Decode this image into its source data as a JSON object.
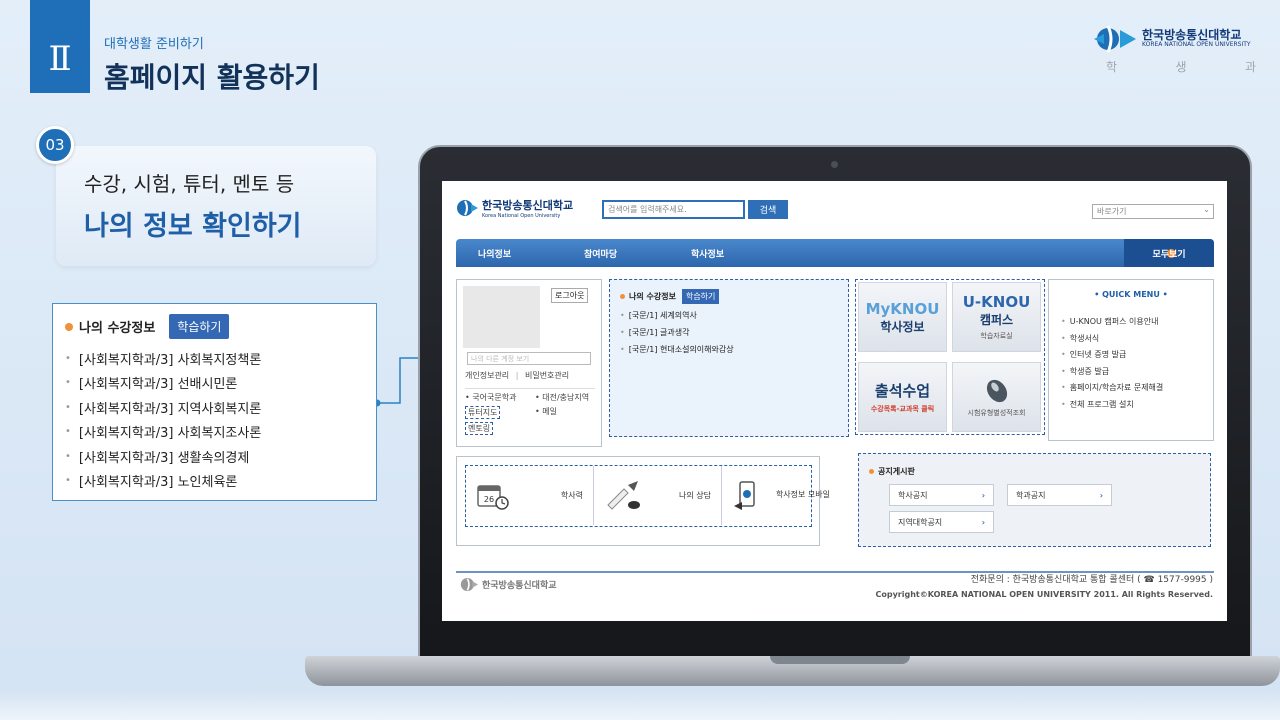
{
  "header": {
    "roman": "Ⅱ",
    "subtitle": "대학생활 준비하기",
    "title": "홈페이지 활용하기",
    "logo_name": "한국방송통신대학교",
    "logo_eng": "KOREA NATIONAL OPEN UNIVERSITY",
    "logo_sub": [
      "학",
      "생",
      "과"
    ]
  },
  "step": {
    "number": "03",
    "line1": "수강, 시험, 튜터, 멘토 등",
    "line2": "나의 정보 확인하기"
  },
  "callout": {
    "heading": "나의 수강정보",
    "button": "학습하기",
    "items": [
      "[사회복지학과/3] 사회복지정책론",
      "[사회복지학과/3] 선배시민론",
      "[사회복지학과/3] 지역사회복지론",
      "[사회복지학과/3] 사회복지조사론",
      "[사회복지학과/3] 생활속의경제",
      "[사회복지학과/3] 노인체육론"
    ]
  },
  "screen": {
    "logo_text": "한국방송통신대학교",
    "logo_sub": "Korea National Open University",
    "search_placeholder": "검색어를 입력해주세요.",
    "search_btn": "검색",
    "goto": "바로가기",
    "nav": [
      "나의정보",
      "참여마당",
      "학사정보"
    ],
    "nav_all": "모두보기",
    "logout": "로그아웃",
    "account_select": "나의 다른 계정 보기",
    "links": {
      "privacy": "개인정보관리",
      "sep": "|",
      "password": "비밀번호관리"
    },
    "sub1": "국어국문학과",
    "sub2": "대전/충남지역",
    "tutor": "튜터지도",
    "mail": "메일",
    "mentor": "멘토링",
    "course": {
      "heading": "나의 수강정보",
      "button": "학습하기",
      "items": [
        "[국문/1] 세계의역사",
        "[국문/1] 글과생각",
        "[국문/1] 현대소설의이해와감상"
      ]
    },
    "tiles": {
      "myknou": "MyKNOU",
      "myknou_sub": "학사정보",
      "uknou": "U-KNOU",
      "uknou_sub": "캠퍼스",
      "uknou_tiny": "학습자료실",
      "attend": "출석수업",
      "attend_tiny": "수강목록-교과목 클릭",
      "exam_tiny": "시험유형별성적조회"
    },
    "quick": {
      "title": "• QUICK MENU •",
      "items": [
        "U-KNOU 캠퍼스 이용안내",
        "학생서식",
        "인터넷 증명 발급",
        "학생증 발급",
        "홈페이지/학습자료 문제해결",
        "전체 프로그램 설치"
      ]
    },
    "bottom_tiles": [
      "학사력",
      "나의 상담",
      "학사정보 모바일"
    ],
    "calendar_num": "26",
    "notice": {
      "heading": "공지게시판",
      "buttons": [
        "학사공지",
        "학과공지",
        "지역대학공지"
      ]
    },
    "footer": {
      "logo": "한국방송통신대학교",
      "tel": "전화문의 : 한국방송통신대학교 통합 콜센터 ( ☎ 1577-9995 )",
      "copy": "Copyright©KOREA NATIONAL OPEN UNIVERSITY 2011. All Rights Reserved."
    }
  },
  "colors": {
    "primary": "#1f6fb8",
    "navy": "#12325a",
    "accent": "#f0903a"
  }
}
